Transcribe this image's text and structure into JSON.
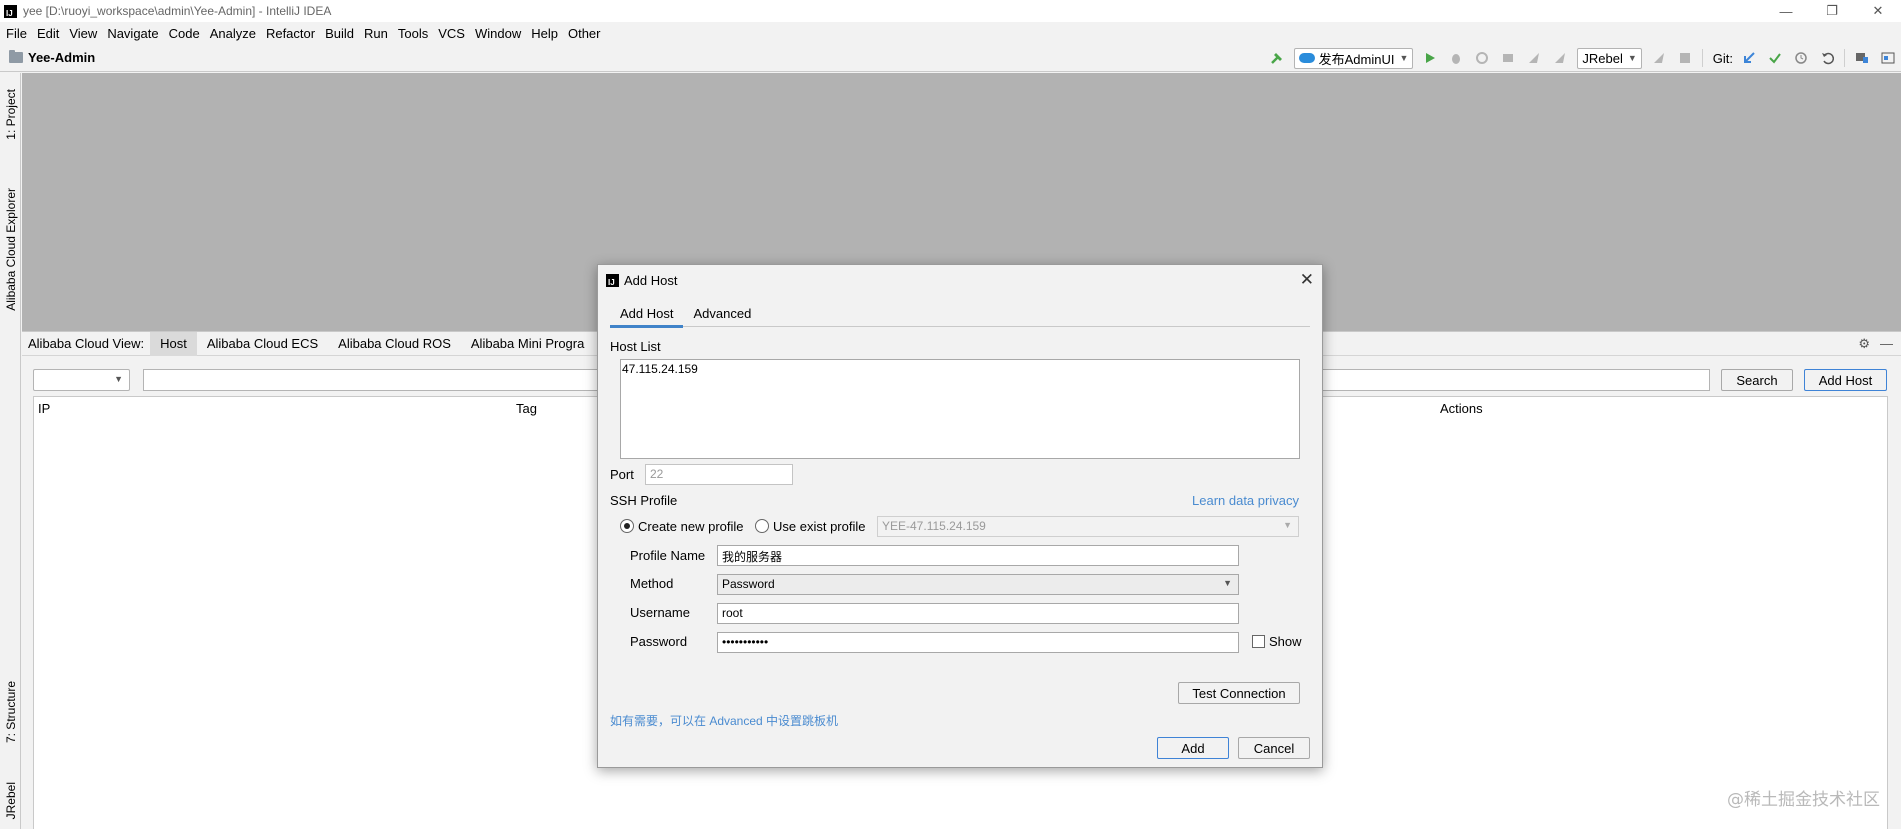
{
  "window": {
    "title": "yee [D:\\ruoyi_workspace\\admin\\Yee-Admin] - IntelliJ IDEA",
    "minimize": "—",
    "restore": "❐",
    "close": "✕"
  },
  "menu": [
    "File",
    "Edit",
    "View",
    "Navigate",
    "Code",
    "Analyze",
    "Refactor",
    "Build",
    "Run",
    "Tools",
    "VCS",
    "Window",
    "Help",
    "Other"
  ],
  "navbar": {
    "project": "Yee-Admin",
    "run_config": "发布AdminUI",
    "jrebel_combo": "JRebel",
    "git_label": "Git:"
  },
  "left_stripe": {
    "project": "1: Project",
    "cloud_explorer": "Alibaba Cloud Explorer",
    "structure": "7: Structure",
    "jrebel": "JRebel"
  },
  "toolwindow": {
    "label": "Alibaba Cloud View:",
    "tabs": [
      "Host",
      "Alibaba Cloud ECS",
      "Alibaba Cloud ROS",
      "Alibaba Mini Progra"
    ],
    "search_button": "Search",
    "add_host_button": "Add Host",
    "columns": [
      "IP",
      "Tag",
      "Actions"
    ]
  },
  "dialog": {
    "title": "Add Host",
    "tabs": [
      "Add Host",
      "Advanced"
    ],
    "host_list_label": "Host List",
    "host_list_value": "47.115.24.159",
    "port_label": "Port",
    "port_placeholder": "22",
    "ssh_profile_label": "SSH Profile",
    "learn_privacy": "Learn data privacy",
    "radio_create": "Create new profile",
    "radio_use_exist": "Use exist profile",
    "exist_profile_value": "YEE-47.115.24.159",
    "profile_name_label": "Profile Name",
    "profile_name_value": "我的服务器",
    "method_label": "Method",
    "method_value": "Password",
    "username_label": "Username",
    "username_value": "root",
    "password_label": "Password",
    "password_value": "•••••••••••",
    "show_label": "Show",
    "test_connection": "Test Connection",
    "hint": "如有需要，可以在 Advanced 中设置跳板机",
    "add_button": "Add",
    "cancel_button": "Cancel"
  },
  "watermark": "@稀土掘金技术社区",
  "colors": {
    "editor_bg": "#b2b2b2",
    "accent": "#4083c9",
    "link": "#4a8bd0",
    "run_green": "#49a548"
  }
}
